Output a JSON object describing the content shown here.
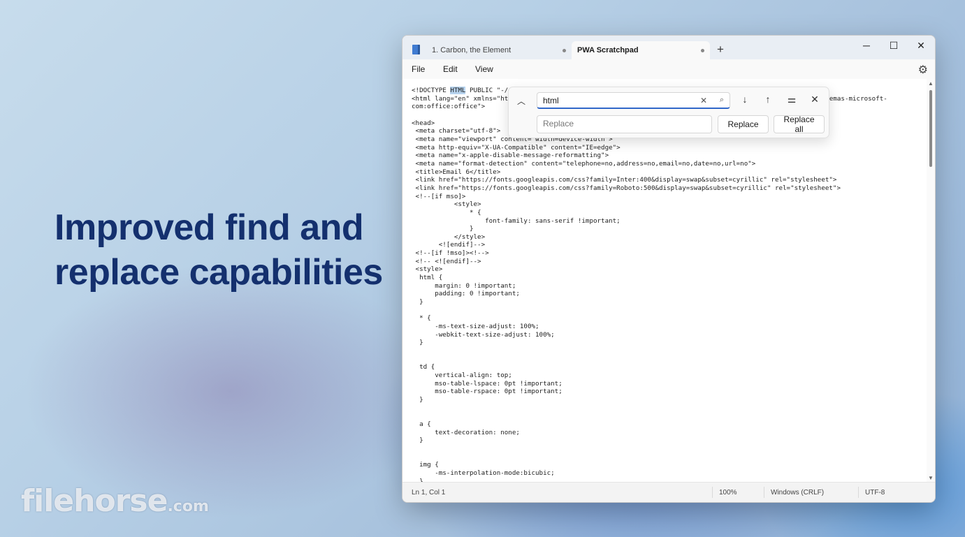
{
  "promo": {
    "headline_line1": "Improved find and",
    "headline_line2": "replace capabilities",
    "watermark_main": "filehorse",
    "watermark_suffix": ".com"
  },
  "window": {
    "tabs": [
      {
        "label": "1. Carbon, the Element",
        "active": false
      },
      {
        "label": "PWA Scratchpad",
        "active": true
      }
    ],
    "new_tab": "+",
    "controls": {
      "minimize": "─",
      "maximize": "☐",
      "close": "✕"
    }
  },
  "menu": {
    "file": "File",
    "edit": "Edit",
    "view": "View"
  },
  "icons": {
    "app": "notepad-icon",
    "settings": "gear-icon",
    "find_next": "arrow-down-icon",
    "find_prev": "arrow-up-icon",
    "options": "sliders-icon",
    "close_find": "close-icon"
  },
  "find": {
    "query": "html",
    "replace_placeholder": "Replace",
    "replace_label": "Replace",
    "replace_all_label": "Replace all"
  },
  "editor": {
    "highlight_word": "HTML",
    "line1_before": "<!DOCTYPE ",
    "line1_after": " PUBLIC \"-/",
    "line2_left": "<html lang=\"en\" xmlns=\"ht",
    "line2_right": "hemas-microsoft-",
    "lines": [
      "com:office:office\">",
      "",
      "<head>",
      " <meta charset=\"utf-8\">",
      " <meta name=\"viewport\" content=\"width=device-width\">",
      " <meta http-equiv=\"X-UA-Compatible\" content=\"IE=edge\">",
      " <meta name=\"x-apple-disable-message-reformatting\">",
      " <meta name=\"format-detection\" content=\"telephone=no,address=no,email=no,date=no,url=no\">",
      " <title>Email 6</title>",
      " <link href=\"https://fonts.googleapis.com/css?family=Inter:400&display=swap&subset=cyrillic\" rel=\"stylesheet\">",
      " <link href=\"https://fonts.googleapis.com/css?family=Roboto:500&display=swap&subset=cyrillic\" rel=\"stylesheet\">",
      " <!--[if mso]>",
      "           <style>",
      "               * {",
      "                   font-family: sans-serif !important;",
      "               }",
      "           </style>",
      "       <![endif]-->",
      " <!--[if !mso]><!-->",
      " <!-- <![endif]-->",
      " <style>",
      "  html {",
      "      margin: 0 !important;",
      "      padding: 0 !important;",
      "  }",
      "",
      "  * {",
      "      -ms-text-size-adjust: 100%;",
      "      -webkit-text-size-adjust: 100%;",
      "  }",
      "",
      "",
      "  td {",
      "      vertical-align: top;",
      "      mso-table-lspace: 0pt !important;",
      "      mso-table-rspace: 0pt !important;",
      "  }",
      "",
      "",
      "  a {",
      "      text-decoration: none;",
      "  }",
      "",
      "",
      "  img {",
      "      -ms-interpolation-mode:bicubic;",
      "  }"
    ]
  },
  "status": {
    "position": "Ln 1, Col 1",
    "zoom": "100%",
    "line_ending": "Windows (CRLF)",
    "encoding": "UTF-8"
  }
}
